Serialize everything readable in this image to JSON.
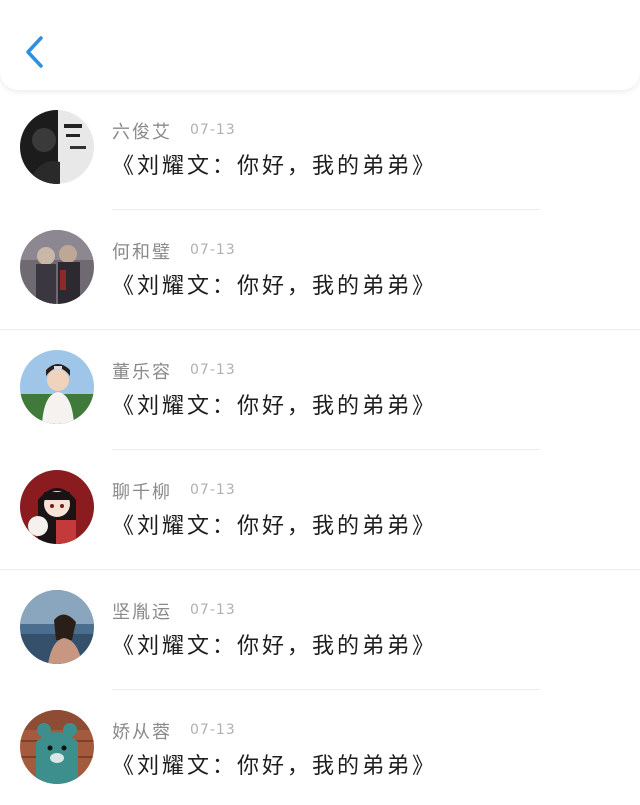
{
  "header": {
    "back_icon": "chevron-left-icon",
    "accent": "#2e8fe0"
  },
  "messages": [
    {
      "name": "六俊艾",
      "date": "07-13",
      "text": "《刘耀文：你好，我的弟弟》"
    },
    {
      "name": "何和璧",
      "date": "07-13",
      "text": "《刘耀文：你好，我的弟弟》"
    },
    {
      "name": "董乐容",
      "date": "07-13",
      "text": "《刘耀文：你好，我的弟弟》"
    },
    {
      "name": "聊千柳",
      "date": "07-13",
      "text": "《刘耀文：你好，我的弟弟》"
    },
    {
      "name": "坚胤运",
      "date": "07-13",
      "text": "《刘耀文：你好，我的弟弟》"
    },
    {
      "name": "娇从蓉",
      "date": "07-13",
      "text": "《刘耀文：你好，我的弟弟》"
    }
  ]
}
